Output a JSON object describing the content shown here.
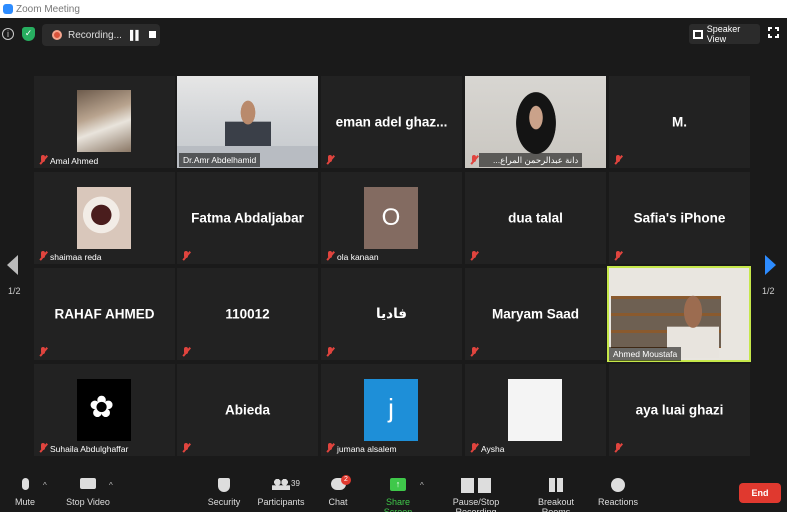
{
  "window": {
    "title": "Zoom Meeting"
  },
  "topbar": {
    "recording_label": "Recording...",
    "speaker_view_label": "Speaker View"
  },
  "gallery": {
    "page_indicator_left": "1/2",
    "page_indicator_right": "1/2",
    "tiles": [
      {
        "label": "Amal Ahmed",
        "center_text": "",
        "kind": "photo"
      },
      {
        "label": "Dr.Amr Abdelhamid",
        "center_text": "",
        "kind": "video"
      },
      {
        "label": "",
        "center_text": "eman  adel  ghaz...",
        "kind": "name"
      },
      {
        "label": "...دانة عبدالرحمن المراع",
        "center_text": "",
        "kind": "video"
      },
      {
        "label": "",
        "center_text": "M.",
        "kind": "name"
      },
      {
        "label": "shaimaa reda",
        "center_text": "",
        "kind": "photo"
      },
      {
        "label": "",
        "center_text": "Fatma Abdaljabar",
        "kind": "name"
      },
      {
        "label": "ola kanaan",
        "center_text": "O",
        "kind": "letter"
      },
      {
        "label": "",
        "center_text": "dua talal",
        "kind": "name"
      },
      {
        "label": "",
        "center_text": "Safia's iPhone",
        "kind": "name"
      },
      {
        "label": "",
        "center_text": "RAHAF AHMED",
        "kind": "name"
      },
      {
        "label": "",
        "center_text": "110012",
        "kind": "name"
      },
      {
        "label": "",
        "center_text": "فاديا",
        "kind": "name"
      },
      {
        "label": "",
        "center_text": "Maryam Saad",
        "kind": "name"
      },
      {
        "label": "Ahmed Moustafa",
        "center_text": "",
        "kind": "video"
      },
      {
        "label": "Suhaila Abdulghaffar",
        "center_text": "",
        "kind": "photo"
      },
      {
        "label": "",
        "center_text": "Abieda",
        "kind": "name"
      },
      {
        "label": "jumana alsalem",
        "center_text": "j",
        "kind": "letter"
      },
      {
        "label": "Aysha",
        "center_text": "",
        "kind": "photo"
      },
      {
        "label": "",
        "center_text": "aya luai ghazi",
        "kind": "name"
      }
    ]
  },
  "toolbar": {
    "mute": "Mute",
    "stop_video": "Stop Video",
    "security": "Security",
    "participants": "Participants",
    "participants_count": "39",
    "chat": "Chat",
    "chat_badge": "2",
    "share_screen": "Share Screen",
    "pause_stop_recording": "Pause/Stop Recording",
    "breakout_rooms": "Breakout Rooms",
    "reactions": "Reactions",
    "end": "End"
  },
  "colors": {
    "share_screen": "#3fc84a",
    "end_button": "#e0392f",
    "active_speaker_border": "#c6e84a",
    "nav_arrow": "#2d8cff"
  }
}
